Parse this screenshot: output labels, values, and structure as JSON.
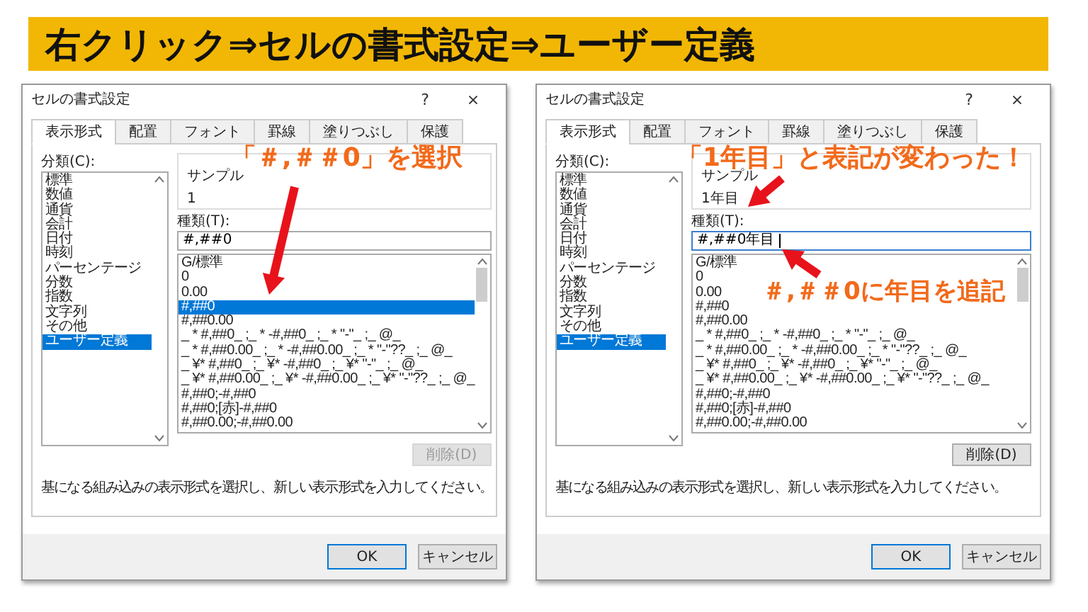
{
  "banner": {
    "title": "右クリック⇒セルの書式設定⇒ユーザー定義"
  },
  "dialogs": [
    {
      "title": "セルの書式設定",
      "help": "?",
      "close": "×",
      "tabs": [
        {
          "label": "表示形式",
          "selected": true
        },
        {
          "label": "配置",
          "selected": false
        },
        {
          "label": "フォント",
          "selected": false
        },
        {
          "label": "罫線",
          "selected": false
        },
        {
          "label": "塗りつぶし",
          "selected": false
        },
        {
          "label": "保護",
          "selected": false
        }
      ],
      "category_label": "分類(C):",
      "categories": [
        {
          "label": "標準",
          "selected": false
        },
        {
          "label": "数値",
          "selected": false
        },
        {
          "label": "通貨",
          "selected": false
        },
        {
          "label": "会計",
          "selected": false
        },
        {
          "label": "日付",
          "selected": false
        },
        {
          "label": "時刻",
          "selected": false
        },
        {
          "label": "パーセンテージ",
          "selected": false
        },
        {
          "label": "分数",
          "selected": false
        },
        {
          "label": "指数",
          "selected": false
        },
        {
          "label": "文字列",
          "selected": false
        },
        {
          "label": "その他",
          "selected": false
        },
        {
          "label": "ユーザー定義",
          "selected": true
        }
      ],
      "sample_label": "サンプル",
      "sample_value": "1",
      "type_label": "種類(T):",
      "type_value": "#,##0",
      "type_focused": false,
      "formats": [
        {
          "label": "G/標準",
          "selected": false
        },
        {
          "label": "0",
          "selected": false
        },
        {
          "label": "0.00",
          "selected": false
        },
        {
          "label": "#,##0",
          "selected": true
        },
        {
          "label": "#,##0.00",
          "selected": false
        },
        {
          "label": "_ * #,##0_ ;_ * -#,##0_ ;_ * \"-\"_ ;_ @_",
          "selected": false
        },
        {
          "label": "_ * #,##0.00_ ;_ * -#,##0.00_ ;_ * \"-\"??_ ;_ @_",
          "selected": false
        },
        {
          "label": "_ ¥* #,##0_ ;_ ¥* -#,##0_ ;_ ¥* \"-\"_ ;_ @_",
          "selected": false
        },
        {
          "label": "_ ¥* #,##0.00_ ;_ ¥* -#,##0.00_ ;_ ¥* \"-\"??_ ;_ @_",
          "selected": false
        },
        {
          "label": "#,##0;-#,##0",
          "selected": false
        },
        {
          "label": "#,##0;[赤]-#,##0",
          "selected": false
        },
        {
          "label": "#,##0.00;-#,##0.00",
          "selected": false
        }
      ],
      "delete_button": {
        "label": "削除(D)",
        "disabled": true
      },
      "description": "基になる組み込みの表示形式を選択し、新しい表示形式を入力してください。",
      "ok": "OK",
      "cancel": "キャンセル"
    },
    {
      "title": "セルの書式設定",
      "help": "?",
      "close": "×",
      "tabs": [
        {
          "label": "表示形式",
          "selected": true
        },
        {
          "label": "配置",
          "selected": false
        },
        {
          "label": "フォント",
          "selected": false
        },
        {
          "label": "罫線",
          "selected": false
        },
        {
          "label": "塗りつぶし",
          "selected": false
        },
        {
          "label": "保護",
          "selected": false
        }
      ],
      "category_label": "分類(C):",
      "categories": [
        {
          "label": "標準",
          "selected": false
        },
        {
          "label": "数値",
          "selected": false
        },
        {
          "label": "通貨",
          "selected": false
        },
        {
          "label": "会計",
          "selected": false
        },
        {
          "label": "日付",
          "selected": false
        },
        {
          "label": "時刻",
          "selected": false
        },
        {
          "label": "パーセンテージ",
          "selected": false
        },
        {
          "label": "分数",
          "selected": false
        },
        {
          "label": "指数",
          "selected": false
        },
        {
          "label": "文字列",
          "selected": false
        },
        {
          "label": "その他",
          "selected": false
        },
        {
          "label": "ユーザー定義",
          "selected": true
        }
      ],
      "sample_label": "サンプル",
      "sample_value": "1年目",
      "type_label": "種類(T):",
      "type_value": "#,##0年目",
      "type_focused": true,
      "formats": [
        {
          "label": "G/標準",
          "selected": false
        },
        {
          "label": "0",
          "selected": false
        },
        {
          "label": "0.00",
          "selected": false
        },
        {
          "label": "#,##0",
          "selected": false
        },
        {
          "label": "#,##0.00",
          "selected": false
        },
        {
          "label": "_ * #,##0_ ;_ * -#,##0_ ;_ * \"-\"_ ;_ @_",
          "selected": false
        },
        {
          "label": "_ * #,##0.00_ ;_ * -#,##0.00_ ;_ * \"-\"??_ ;_ @_",
          "selected": false
        },
        {
          "label": "_ ¥* #,##0_ ;_ ¥* -#,##0_ ;_ ¥* \"-\"_ ;_ @_",
          "selected": false
        },
        {
          "label": "_ ¥* #,##0.00_ ;_ ¥* -#,##0.00_ ;_ ¥* \"-\"??_ ;_ @_",
          "selected": false
        },
        {
          "label": "#,##0;-#,##0",
          "selected": false
        },
        {
          "label": "#,##0;[赤]-#,##0",
          "selected": false
        },
        {
          "label": "#,##0.00;-#,##0.00",
          "selected": false
        }
      ],
      "delete_button": {
        "label": "削除(D)",
        "disabled": false
      },
      "description": "基になる組み込みの表示形式を選択し、新しい表示形式を入力してください。",
      "ok": "OK",
      "cancel": "キャンセル"
    }
  ],
  "annotations": [
    {
      "text": "「＃,＃＃0」を選択"
    },
    {
      "text": "「1年目」と表記が変わった！"
    },
    {
      "text": "＃,＃＃0に年目を追記"
    }
  ]
}
